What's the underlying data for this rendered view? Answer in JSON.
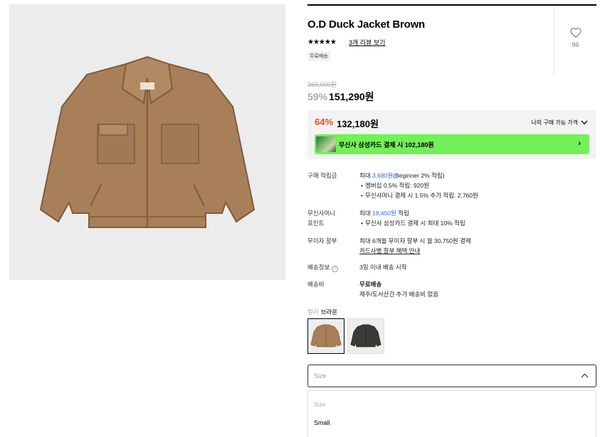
{
  "product": {
    "title": "O.D Duck Jacket Brown",
    "stars": "★★★★★",
    "review_link": "3개 리뷰 보기",
    "free_shipping_tag": "무료배송",
    "wishlist_count": "96"
  },
  "price": {
    "original": "369,000원",
    "discount_pct": "59%",
    "sale": "151,290원"
  },
  "benefit": {
    "best_pct": "64%",
    "best_price": "132,180원",
    "my_price_label": "나의 구매 가능 가격",
    "card_banner": "무신사 삼성카드 결제 시 102,180원",
    "card_arrow": "›"
  },
  "details": {
    "points": {
      "label": "구매 적립금",
      "prefix": "최대 ",
      "amount": "3,680원",
      "suffix": "(Beginner 2% 적립)",
      "bullets": [
        "멤버십 0.5% 적립: 920원",
        "무신사머니 결제 시 1.5% 추가 적립: 2,760원"
      ]
    },
    "money": {
      "label1": "무신사머니",
      "label2": "포인트",
      "prefix": "최대 ",
      "amount": "18,450원",
      "suffix": " 적립",
      "bullets": [
        "무신사 삼성카드 결제 시 최대 10% 적립"
      ]
    },
    "installment": {
      "label": "무이자 할부",
      "line1": "최대 6개월 무이자 할부 시 월 30,750원 결제",
      "link": "카드사별 할부 혜택 안내"
    },
    "shipping_info": {
      "label": "배송정보",
      "info_icon": "?",
      "value": "3일 이내 배송 시작"
    },
    "shipping_fee": {
      "label": "배송비",
      "value1": "무료배송",
      "value2": "제주/도서산간 추가 배송비 없음"
    }
  },
  "color": {
    "label": "컬러",
    "selected": "브라운"
  },
  "size": {
    "placeholder": "Size",
    "options": [
      "Size",
      "Small"
    ]
  },
  "colors": {
    "accent_red": "#ee4c2c",
    "card_green": "#73ef5a",
    "link_blue": "#2b6cf0",
    "jacket_brown": "#a87f58"
  }
}
